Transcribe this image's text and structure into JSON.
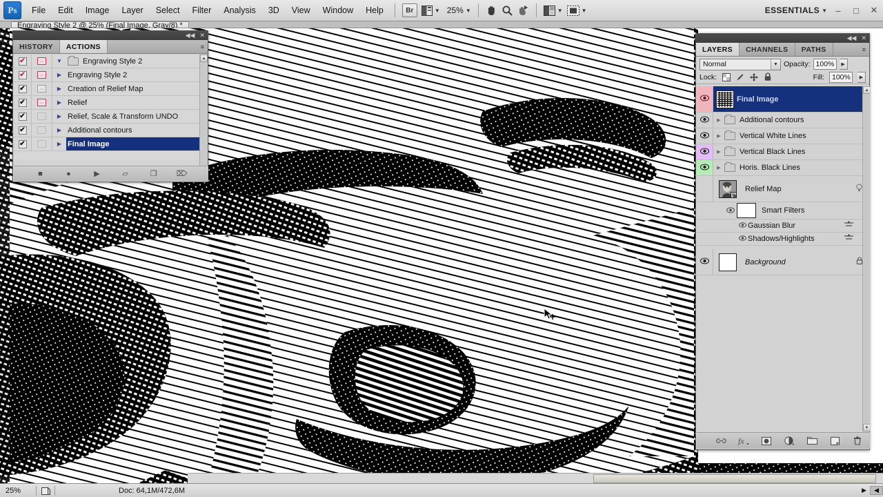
{
  "app": {
    "logo": "Ps",
    "workspace": "ESSENTIALS",
    "zoom_label": "25%",
    "bridge_label": "Br"
  },
  "menubar": {
    "items": [
      {
        "label": "File"
      },
      {
        "label": "Edit"
      },
      {
        "label": "Image"
      },
      {
        "label": "Layer"
      },
      {
        "label": "Select"
      },
      {
        "label": "Filter"
      },
      {
        "label": "Analysis"
      },
      {
        "label": "3D"
      },
      {
        "label": "View"
      },
      {
        "label": "Window"
      },
      {
        "label": "Help"
      }
    ],
    "tools": [
      {
        "name": "hand-tool",
        "glyph": "✋"
      },
      {
        "name": "zoom-tool",
        "glyph": "⌕"
      },
      {
        "name": "rotate-view-tool",
        "glyph": "➦"
      }
    ],
    "window_controls": {
      "minimize": "–",
      "maximize": "□",
      "close": "✕"
    }
  },
  "document": {
    "tab_title": "Engraving Style 2 @ 25% (Final Image, Gray/8) *"
  },
  "statusbar": {
    "zoom": "25%",
    "doc_info": "Doc: 64,1M/472,6M",
    "arrow_right": "▶",
    "arrow_left": "◀"
  },
  "actions_panel": {
    "tabs": [
      {
        "label": "HISTORY",
        "active": false
      },
      {
        "label": "ACTIONS",
        "active": true
      }
    ],
    "rows": [
      {
        "label": "Engraving Style 2",
        "checked": true,
        "check_color": "red",
        "dialog": "on",
        "kind": "set",
        "expanded": true,
        "selected": false
      },
      {
        "label": "Engraving Style 2",
        "checked": true,
        "check_color": "red",
        "dialog": "on",
        "kind": "action",
        "selected": false
      },
      {
        "label": "Creation of Relief Map",
        "checked": true,
        "check_color": "black",
        "dialog": "neutral",
        "kind": "action",
        "selected": false
      },
      {
        "label": "Relief",
        "checked": true,
        "check_color": "black",
        "dialog": "on",
        "kind": "action",
        "selected": false
      },
      {
        "label": "Relief, Scale & Transform UNDO",
        "checked": true,
        "check_color": "black",
        "dialog": "off",
        "kind": "action",
        "selected": false
      },
      {
        "label": "Additional contours",
        "checked": true,
        "check_color": "black",
        "dialog": "off",
        "kind": "action",
        "selected": false
      },
      {
        "label": "Final Image",
        "checked": true,
        "check_color": "black",
        "dialog": "off",
        "kind": "action",
        "selected": true
      }
    ],
    "footer_icons": [
      {
        "name": "stop-icon",
        "glyph": "■"
      },
      {
        "name": "record-icon",
        "glyph": "●"
      },
      {
        "name": "play-icon",
        "glyph": "▶"
      },
      {
        "name": "new-set-icon",
        "glyph": "▱"
      },
      {
        "name": "new-action-icon",
        "glyph": "❐"
      },
      {
        "name": "delete-icon",
        "glyph": "⌦"
      }
    ]
  },
  "layers_panel": {
    "tabs": [
      {
        "label": "LAYERS",
        "active": true
      },
      {
        "label": "CHANNELS",
        "active": false
      },
      {
        "label": "PATHS",
        "active": false
      }
    ],
    "blend_mode": "Normal",
    "opacity_label": "Opacity:",
    "opacity_value": "100%",
    "fill_label": "Fill:",
    "fill_value": "100%",
    "lock_label": "Lock:",
    "lock_icons": [
      {
        "name": "lock-transparency-icon",
        "glyph": "▨"
      },
      {
        "name": "lock-image-icon",
        "glyph": "✐"
      },
      {
        "name": "lock-position-icon",
        "glyph": "✚"
      },
      {
        "name": "lock-all-icon",
        "glyph": "🔒"
      }
    ],
    "layers": [
      {
        "name": "Final Image",
        "visible": true,
        "type": "image",
        "selected": true,
        "badge_color": "#f0b4bc",
        "thumb": "pattern"
      },
      {
        "name": "Additional contours",
        "visible": true,
        "type": "group",
        "selected": false,
        "badge_color": "#d2d2d2"
      },
      {
        "name": "Vertical White Lines",
        "visible": true,
        "type": "group",
        "selected": false,
        "badge_color": "#d2d2d2"
      },
      {
        "name": "Vertical Black Lines",
        "visible": true,
        "type": "group",
        "selected": false,
        "badge_color": "#e3bdf5"
      },
      {
        "name": "Horis. Black Lines",
        "visible": true,
        "type": "group",
        "selected": false,
        "badge_color": "#b6ebb6"
      },
      {
        "name": "Relief Map",
        "visible": false,
        "type": "smartobject",
        "selected": false,
        "badge_color": "#d2d2d2",
        "thumb": "portrait"
      }
    ],
    "smart_filters": {
      "label": "Smart Filters",
      "visible": true,
      "filters": [
        {
          "name": "Gaussian Blur",
          "visible": true
        },
        {
          "name": "Shadows/Highlights",
          "visible": true
        }
      ]
    },
    "background_layer": {
      "name": "Background",
      "visible": true,
      "locked": true
    },
    "footer_icons": [
      {
        "name": "link-layers-icon",
        "glyph": "☍"
      },
      {
        "name": "layer-style-icon",
        "glyph": "ƒx"
      },
      {
        "name": "layer-mask-icon",
        "glyph": "◎"
      },
      {
        "name": "adjustment-layer-icon",
        "glyph": "◑"
      },
      {
        "name": "new-group-icon",
        "glyph": "▭"
      },
      {
        "name": "new-layer-icon",
        "glyph": "❐"
      },
      {
        "name": "delete-layer-icon",
        "glyph": "⌦"
      }
    ]
  },
  "canvas": {
    "artwork_description": "Engraved crosshatch halftone portrait"
  }
}
